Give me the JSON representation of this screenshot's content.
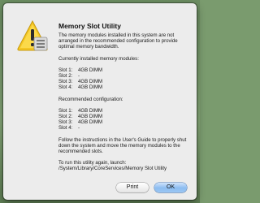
{
  "dialog": {
    "title": "Memory Slot Utility",
    "icon": "caution-icon",
    "message": "The memory modules installed in this system are not arranged in the recommended configuration to provide optimal memory bandwidth.",
    "current_heading": "Currently installed memory modules:",
    "current_slots": [
      {
        "label": "Slot 1:",
        "value": "4GB DIMM"
      },
      {
        "label": "Slot 2:",
        "value": "-"
      },
      {
        "label": "Slot 3:",
        "value": "4GB DIMM"
      },
      {
        "label": "Slot 4:",
        "value": "4GB DIMM"
      }
    ],
    "recommended_heading": "Recommended configuration:",
    "recommended_slots": [
      {
        "label": "Slot 1:",
        "value": "4GB DIMM"
      },
      {
        "label": "Slot 2:",
        "value": "4GB DIMM"
      },
      {
        "label": "Slot 3:",
        "value": "4GB DIMM"
      },
      {
        "label": "Slot 4:",
        "value": "-"
      }
    ],
    "instructions": "Follow the instructions in the User's Guide to properly shut down the system and move the memory modules to the recommended slots.",
    "rerun_note": "To run this utility again, launch: /System/Library/CoreServices/Memory Slot Utility",
    "print_label": "Print",
    "ok_label": "OK"
  }
}
